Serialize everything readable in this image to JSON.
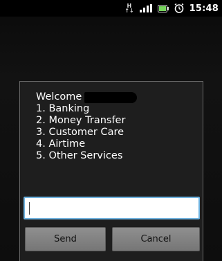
{
  "status_bar": {
    "network_type": "H",
    "time": "15:48",
    "icons": [
      "network-type-icon",
      "signal-icon",
      "battery-icon",
      "alarm-icon"
    ]
  },
  "dialog": {
    "message_lines": [
      "Welcome",
      "1. Banking",
      "2. Money Transfer",
      "3. Customer Care",
      "4. Airtime",
      "5. Other Services"
    ],
    "input_value": "",
    "send_label": "Send",
    "cancel_label": "Cancel"
  },
  "colors": {
    "input_border": "#6fb3e0",
    "battery": "#76d35c"
  }
}
